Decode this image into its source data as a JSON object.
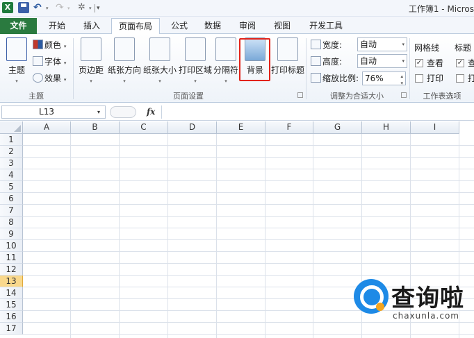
{
  "titlebar": {
    "app_letter": "X",
    "undo_arrow": "▾",
    "redo_arrow": "▾",
    "brush_arrow": "▾",
    "more": "▾",
    "title": "工作簿1 - Micros"
  },
  "tabs": [
    {
      "label": "文件"
    },
    {
      "label": "开始"
    },
    {
      "label": "插入"
    },
    {
      "label": "页面布局"
    },
    {
      "label": "公式"
    },
    {
      "label": "数据"
    },
    {
      "label": "审阅"
    },
    {
      "label": "视图"
    },
    {
      "label": "开发工具"
    }
  ],
  "ribbon": {
    "theme_group": {
      "theme_label": "主题",
      "colors_label": "颜色",
      "fonts_label": "字体",
      "effects_label": "效果",
      "group_label": "主题"
    },
    "page_setup": {
      "margins": "页边距",
      "orientation": "纸张方向",
      "size": "纸张大小",
      "print_area": "打印区域",
      "breaks": "分隔符",
      "background": "背景",
      "print_titles": "打印标题",
      "group_label": "页面设置"
    },
    "scale_to_fit": {
      "width_label": "宽度:",
      "width_value": "自动",
      "height_label": "高度:",
      "height_value": "自动",
      "scale_label": "缩放比例:",
      "scale_value": "76%",
      "group_label": "调整为合适大小"
    },
    "sheet_options": {
      "gridlines_label": "网格线",
      "gridlines_view": "查看",
      "gridlines_print": "打印",
      "headings_label": "标题",
      "headings_view": "查",
      "headings_print": "打",
      "group_label": "工作表选项"
    }
  },
  "formula_bar": {
    "name_box": "L13",
    "fx": "fx",
    "formula": ""
  },
  "grid": {
    "columns": [
      "A",
      "B",
      "C",
      "D",
      "E",
      "F",
      "G",
      "H",
      "I"
    ],
    "rows": [
      "1",
      "2",
      "3",
      "4",
      "5",
      "6",
      "7",
      "8",
      "9",
      "10",
      "11",
      "12",
      "13",
      "14",
      "15",
      "16",
      "17"
    ],
    "active_row": "13"
  },
  "watermark": {
    "brand": "查询啦",
    "domain": "chaxunla.com"
  },
  "colors": {
    "file_tab": "#2a7a3f",
    "highlight": "#e2231a",
    "active_row": "#f9d88c"
  }
}
